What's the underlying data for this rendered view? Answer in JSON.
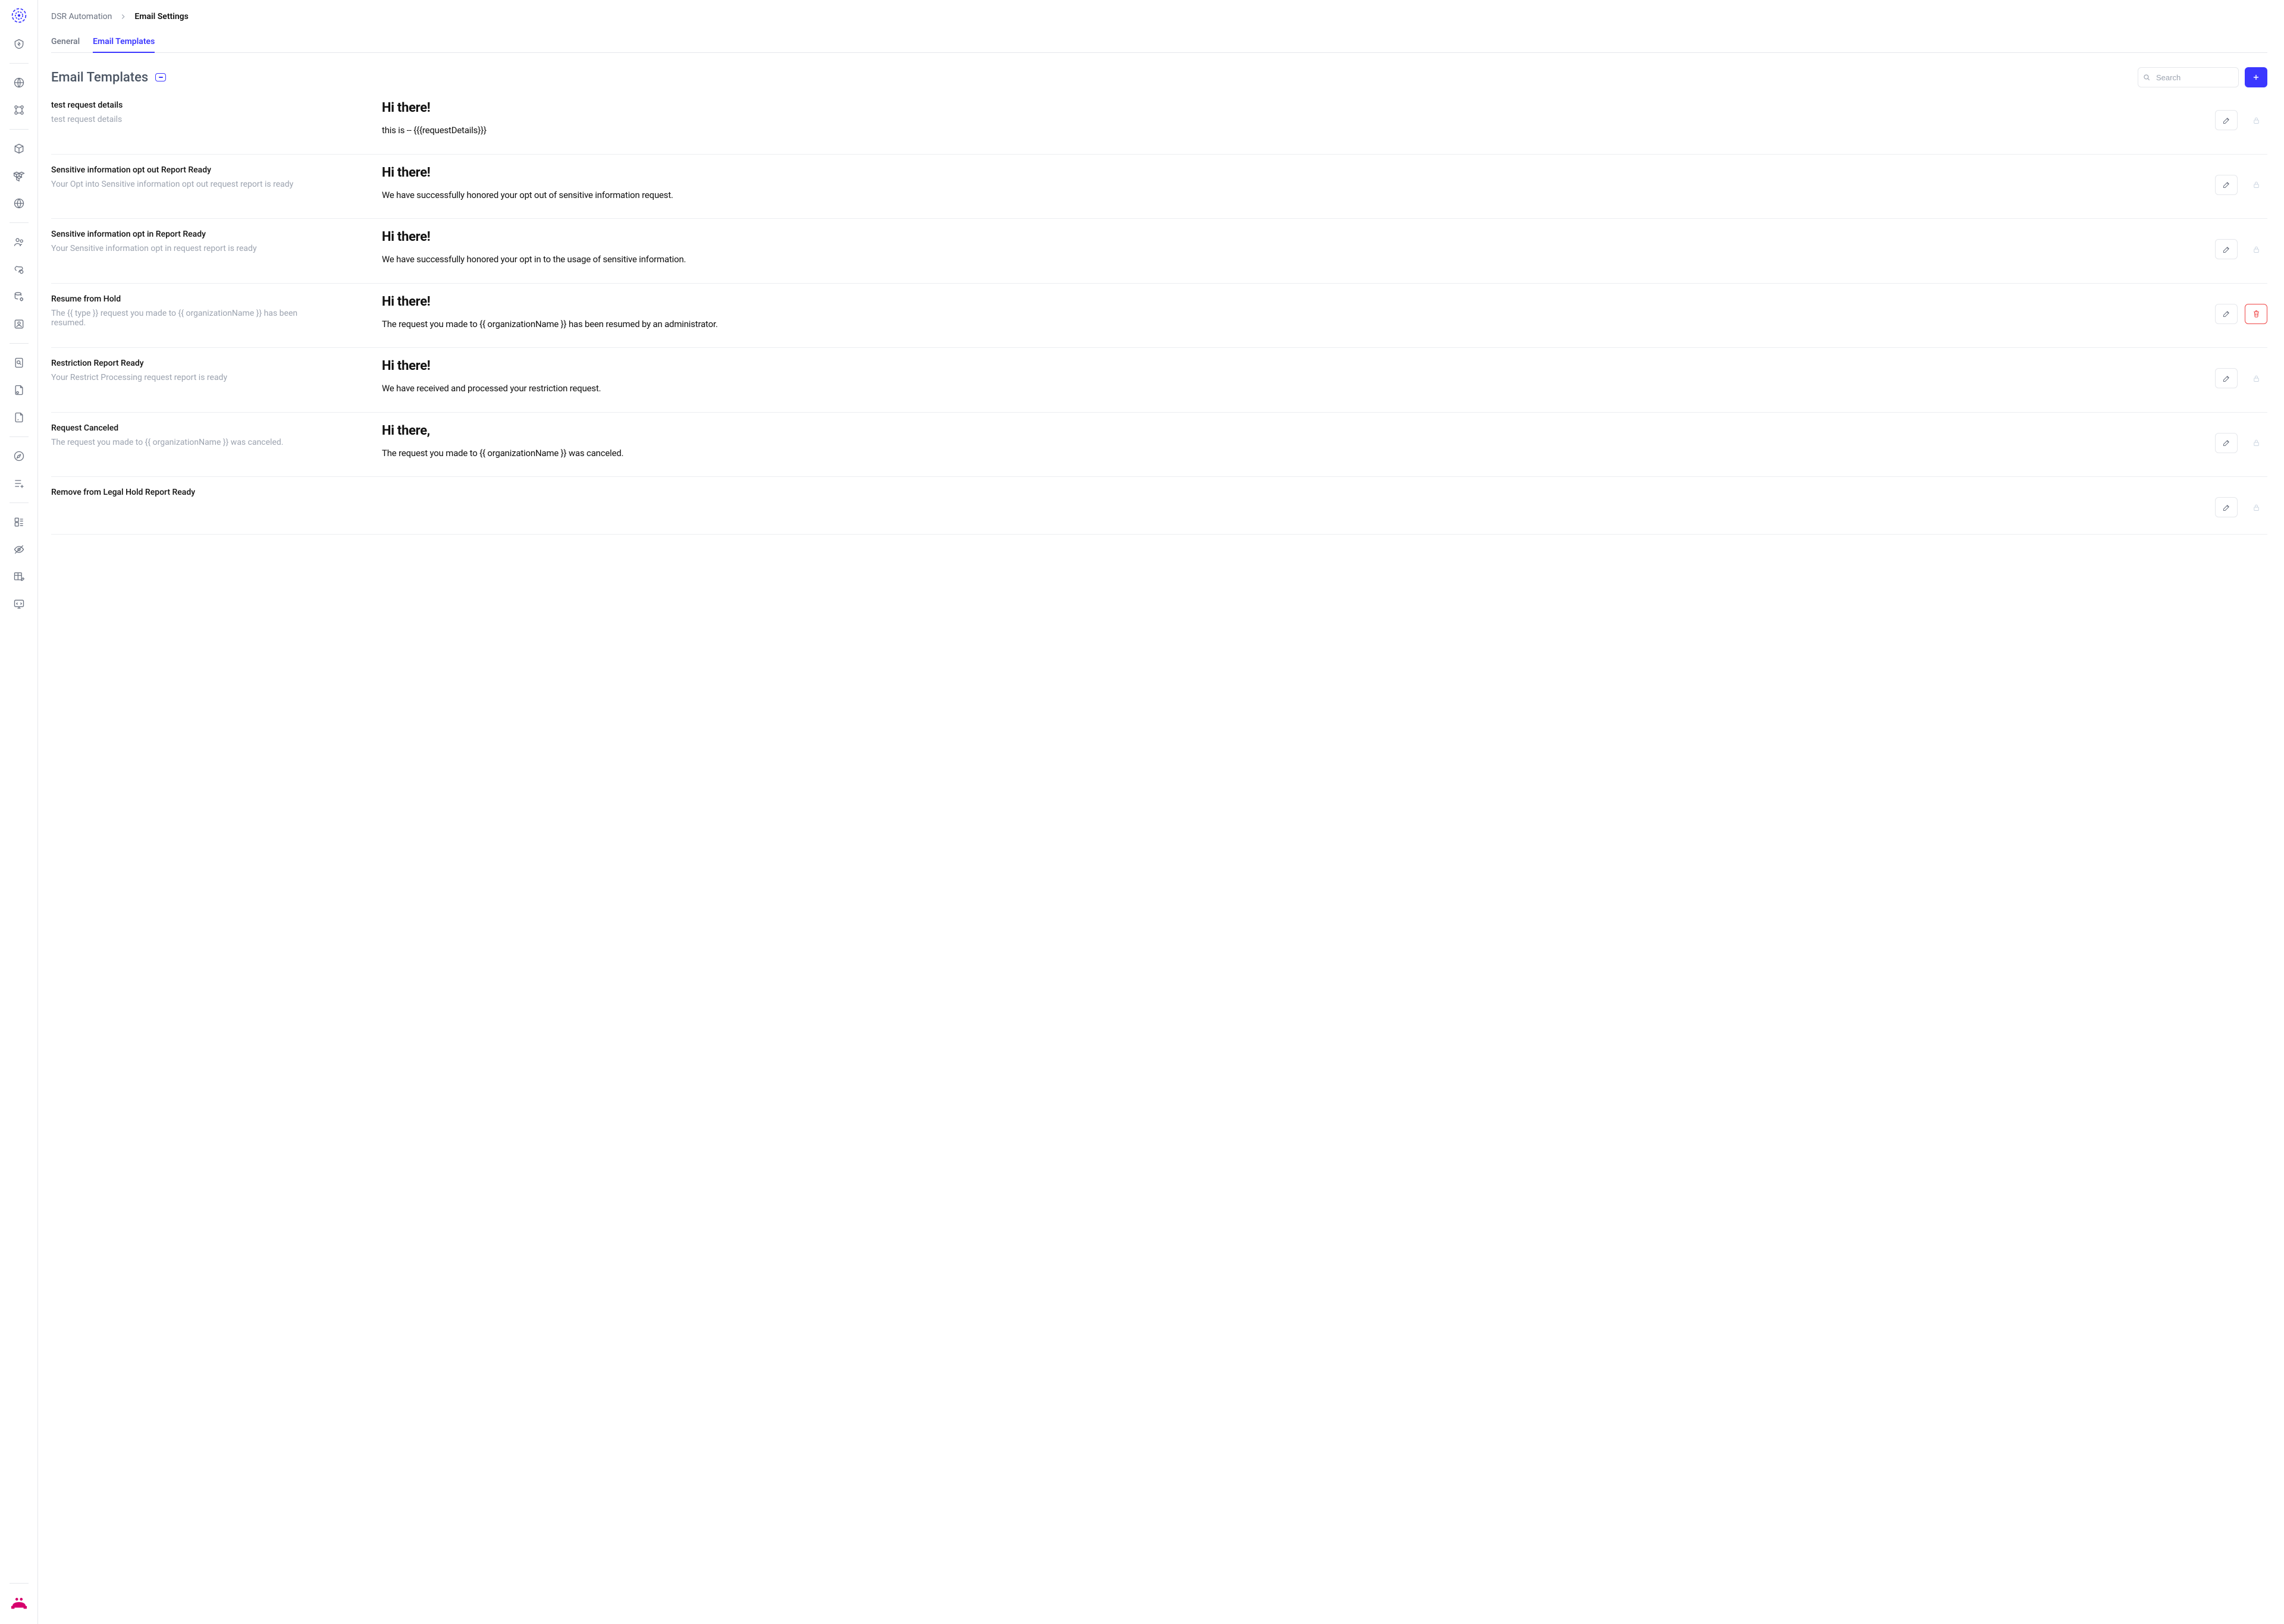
{
  "breadcrumb": {
    "parent": "DSR Automation",
    "current": "Email Settings"
  },
  "tabs": {
    "general": "General",
    "email_templates": "Email Templates"
  },
  "page": {
    "title": "Email Templates"
  },
  "search": {
    "placeholder": "Search"
  },
  "templates": [
    {
      "title": "test request details",
      "subtitle": "test request details",
      "greeting": "Hi there!",
      "body": "this is -- {{{requestDetails}}}",
      "locked": true
    },
    {
      "title": "Sensitive information opt out Report Ready",
      "subtitle": "Your Opt into Sensitive information opt out request report is ready",
      "greeting": "Hi there!",
      "body": "We have successfully honored your opt out of sensitive information request.",
      "locked": true
    },
    {
      "title": "Sensitive information opt in Report Ready",
      "subtitle": "Your Sensitive information opt in request report is ready",
      "greeting": "Hi there!",
      "body": "We have successfully honored your opt in to the usage of sensitive information.",
      "locked": true
    },
    {
      "title": "Resume from Hold",
      "subtitle": "The {{ type }} request you made to {{ organizationName }} has been resumed.",
      "greeting": "Hi there!",
      "body": "The request you made to {{ organizationName }} has been resumed by an administrator.",
      "locked": false
    },
    {
      "title": "Restriction Report Ready",
      "subtitle": "Your Restrict Processing request report is ready",
      "greeting": "Hi there!",
      "body": "We have received and processed your restriction request.",
      "locked": true
    },
    {
      "title": "Request Canceled",
      "subtitle": "The request you made to {{ organizationName }} was canceled.",
      "greeting": "Hi there,",
      "body": "The request you made to {{ organizationName }} was canceled.",
      "locked": true
    },
    {
      "title": "Remove from Legal Hold Report Ready",
      "subtitle": "",
      "greeting": "",
      "body": "",
      "locked": true
    }
  ]
}
